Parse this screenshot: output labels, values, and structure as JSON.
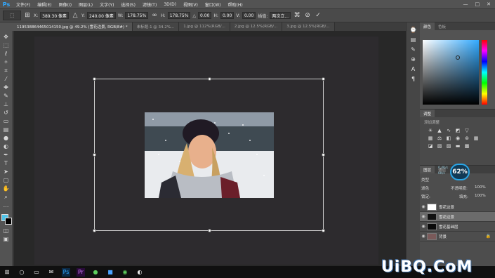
{
  "app": {
    "logo": "Ps"
  },
  "menu": {
    "items": [
      "文件(F)",
      "编辑(E)",
      "图像(I)",
      "图层(L)",
      "文字(Y)",
      "选择(S)",
      "滤镜(T)",
      "3D(D)",
      "视图(V)",
      "窗口(W)",
      "帮助(H)"
    ],
    "window_controls": [
      "—",
      "□",
      "✕"
    ]
  },
  "options": {
    "x_label": "X:",
    "x_value": "389.30 像素",
    "y_label": "Y:",
    "y_value": "240.00 像素",
    "w_label": "W:",
    "w_value": "178.75%",
    "h_label": "H:",
    "h_value": "178.75%",
    "angle_label": "△",
    "angle_value": "0.00",
    "hskew_label": "H:",
    "hskew_value": "0.00",
    "vskew_label": "V:",
    "vskew_value": "0.00",
    "interp_label": "插值:",
    "interp_value": "两次立..."
  },
  "tabs": [
    {
      "label": "1195388644650141​50.jpg @ 49.2% (雪花边景, RGB/8#) *",
      "active": true
    },
    {
      "label": "未标题-1 @ 34.2%...",
      "active": false
    },
    {
      "label": "1.jpg @ 112%(RGB/...",
      "active": false
    },
    {
      "label": "2.jpg @ 12.5%(RGB/...",
      "active": false
    },
    {
      "label": "3.jpg @ 12.5%(RGB/...",
      "active": false
    }
  ],
  "color_panel": {
    "tabs": [
      "颜色",
      "色板"
    ],
    "fg_color": "#4fc3e8",
    "bg_color": "#000000"
  },
  "adjust_panel": {
    "tab": "调整",
    "subtitle": "添加调整"
  },
  "layers_panel": {
    "tabs": [
      "图层",
      "通道",
      "路径"
    ],
    "kind_label": "类型",
    "blend_mode": "滤色",
    "opacity_label": "不透明度:",
    "opacity_value": "100%",
    "lock_label": "锁定:",
    "fill_label": "填充:",
    "fill_value": "100%",
    "layers": [
      {
        "name": "雪花边景",
        "selected": false,
        "thumb": "#ffffff",
        "lock": false
      },
      {
        "name": "雪花边景",
        "selected": true,
        "thumb": "#111111",
        "lock": false
      },
      {
        "name": "雪花基础层",
        "selected": false,
        "thumb": "#0a0a0a",
        "lock": false
      },
      {
        "name": "背景",
        "selected": false,
        "thumb": "#7a5a5a",
        "lock": true
      }
    ]
  },
  "performance": {
    "percent": "62%",
    "stat1": "0.4K/s",
    "stat2": "0K/s"
  },
  "watermark": "UiBQ.CoM"
}
